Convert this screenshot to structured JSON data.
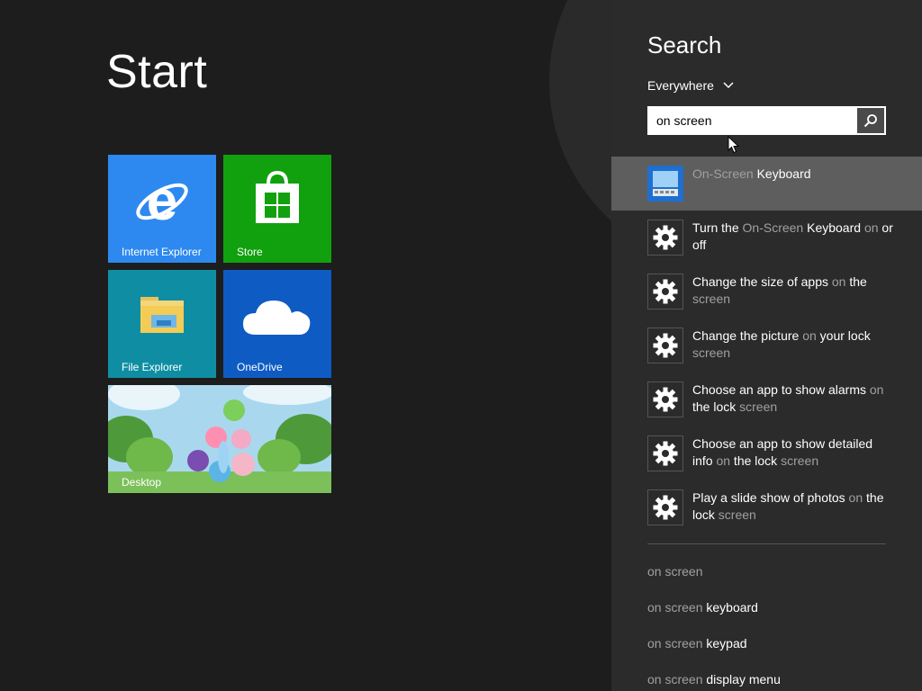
{
  "start": {
    "title": "Start",
    "tiles": [
      {
        "label": "Internet Explorer",
        "icon": "internet-explorer-icon"
      },
      {
        "label": "Store",
        "icon": "store-icon"
      },
      {
        "label": "File Explorer",
        "icon": "folder-icon"
      },
      {
        "label": "OneDrive",
        "icon": "cloud-icon"
      },
      {
        "label": "Desktop",
        "icon": "desktop-wallpaper"
      }
    ]
  },
  "search": {
    "title": "Search",
    "scope": "Everywhere",
    "query": "on screen",
    "results": [
      {
        "parts": [
          {
            "t": "On-Screen",
            "dim": true
          },
          {
            "t": " Keyboard",
            "dim": false
          }
        ],
        "icon": "on-screen-keyboard-icon",
        "selected": true
      },
      {
        "parts": [
          {
            "t": "Turn the ",
            "dim": false
          },
          {
            "t": "On-Screen",
            "dim": true
          },
          {
            "t": " Keyboard ",
            "dim": false
          },
          {
            "t": "on",
            "dim": true
          },
          {
            "t": " or off",
            "dim": false
          }
        ],
        "icon": "gear-icon"
      },
      {
        "parts": [
          {
            "t": "Change the size of apps ",
            "dim": false
          },
          {
            "t": "on",
            "dim": true
          },
          {
            "t": " the ",
            "dim": false
          },
          {
            "t": "screen",
            "dim": true
          }
        ],
        "icon": "gear-icon"
      },
      {
        "parts": [
          {
            "t": "Change the picture ",
            "dim": false
          },
          {
            "t": "on",
            "dim": true
          },
          {
            "t": " your lock ",
            "dim": false
          },
          {
            "t": "screen",
            "dim": true
          }
        ],
        "icon": "gear-icon"
      },
      {
        "parts": [
          {
            "t": "Choose an app to show alarms ",
            "dim": false
          },
          {
            "t": "on",
            "dim": true
          },
          {
            "t": " the lock ",
            "dim": false
          },
          {
            "t": "screen",
            "dim": true
          }
        ],
        "icon": "gear-icon"
      },
      {
        "parts": [
          {
            "t": "Choose an app to show detailed info ",
            "dim": false
          },
          {
            "t": "on",
            "dim": true
          },
          {
            "t": " the lock ",
            "dim": false
          },
          {
            "t": "screen",
            "dim": true
          }
        ],
        "icon": "gear-icon"
      },
      {
        "parts": [
          {
            "t": "Play a slide show of photos ",
            "dim": false
          },
          {
            "t": "on",
            "dim": true
          },
          {
            "t": " the lock ",
            "dim": false
          },
          {
            "t": "screen",
            "dim": true
          }
        ],
        "icon": "gear-icon"
      }
    ],
    "suggestions": [
      {
        "dim": "on screen",
        "rest": ""
      },
      {
        "dim": "on screen",
        "rest": " keyboard"
      },
      {
        "dim": "on screen",
        "rest": " keypad"
      },
      {
        "dim": "on screen",
        "rest": " display menu"
      }
    ]
  },
  "colors": {
    "background": "#1d1d1d",
    "panel": "#2b2b2b",
    "selected": "#5e5e5e",
    "ie_tile": "#2d89ef",
    "store_tile": "#11a10e",
    "file_explorer_tile": "#0f8ea3",
    "onedrive_tile": "#0e5bc4",
    "dim_text": "#a0a0a0"
  }
}
